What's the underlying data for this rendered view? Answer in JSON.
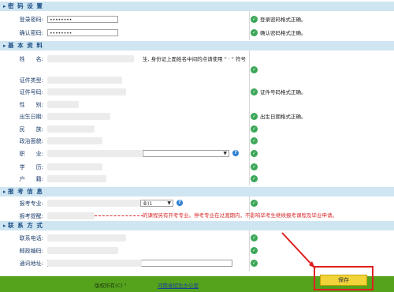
{
  "sections": {
    "password": "密 码 设 置",
    "basic": "基 本 资 料",
    "exam": "报 考 信 息",
    "contact": "联 系 方 式"
  },
  "password": {
    "login_label": "登录密码:",
    "login_value": "••••••••",
    "login_ok": "登录密码格式正确。",
    "confirm_label": "确认密码:",
    "confirm_value": "••••••••",
    "confirm_ok": "确认密码格式正确。"
  },
  "basic": {
    "name_label": "姓　　名:",
    "name_hint": "生, 身份证上面姓名中间的点请使用 \" · \" 符号",
    "id_type_label": "证件类型:",
    "id_no_label": "证件号码:",
    "id_no_ok": "证件号码格式正确。",
    "gender_label": "性　　别:",
    "birth_label": "出生日期:",
    "birth_ok": "出生日期格式正确。",
    "ethnic_label": "民　　族:",
    "politics_label": "政治面貌:",
    "job_label": "职　　业:",
    "edu_label": "学　　历:",
    "hukou_label": "户　　籍:"
  },
  "exam": {
    "major_label": "报考专业:",
    "major_select_tail": "业)1",
    "remind_label": "报考提醒:",
    "remind_text": "的课程另有开考专业。停考专业在过渡期内，不影响毕考生继续报考课程及毕业申请。"
  },
  "contact": {
    "phone_label": "联系电话:",
    "zip_label": "邮政编码:",
    "addr_label": "通讯地址:"
  },
  "footer": {
    "copyright": "版权所有(C) \"",
    "office": "河南省招生办公室"
  },
  "save_label": "保存",
  "colors": {
    "section_bg": "#cfe6f2",
    "footer_bg": "#55a21c",
    "save_bg": "#f1d33a",
    "check": "#3aa657",
    "warning": "#d62828"
  }
}
